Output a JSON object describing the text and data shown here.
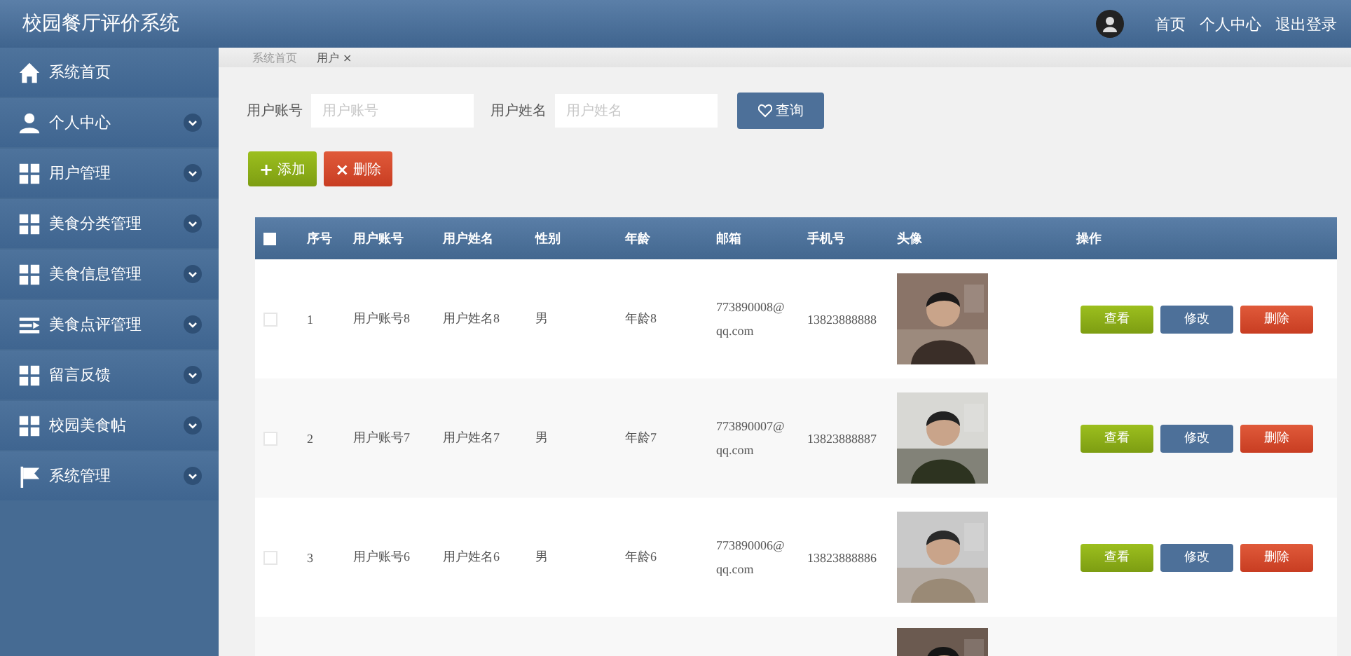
{
  "header": {
    "title": "校园餐厅评价系统",
    "links": [
      "首页",
      "个人中心",
      "退出登录"
    ]
  },
  "sidebar": {
    "items": [
      {
        "label": "系统首页",
        "kind": "link"
      },
      {
        "label": "个人中心",
        "kind": "menu"
      },
      {
        "label": "用户管理",
        "kind": "menu"
      },
      {
        "label": "美食分类管理",
        "kind": "menu"
      },
      {
        "label": "美食信息管理",
        "kind": "menu"
      },
      {
        "label": "美食点评管理",
        "kind": "menu"
      },
      {
        "label": "留言反馈",
        "kind": "menu"
      },
      {
        "label": "校园美食帖",
        "kind": "menu"
      },
      {
        "label": "系统管理",
        "kind": "menu"
      }
    ]
  },
  "breadcrumb": [
    {
      "label": "系统首页",
      "selected": false
    },
    {
      "label": "用户",
      "close": "×",
      "selected": true
    }
  ],
  "search": {
    "fields": [
      {
        "label": "用户账号",
        "placeholder": "用户账号"
      },
      {
        "label": "用户姓名",
        "placeholder": "用户姓名"
      }
    ],
    "button": "查询"
  },
  "actions": [
    {
      "label": "添加",
      "icon": "+",
      "kind": "add"
    },
    {
      "label": "删除",
      "icon": "×",
      "kind": "delete"
    }
  ],
  "table": {
    "select_all": {
      "checked": false
    },
    "columns": [
      "序号",
      "用户账号",
      "用户姓名",
      "性别",
      "年龄",
      "邮箱",
      "手机号",
      "头像",
      "操作"
    ],
    "rows": [
      {
        "checked": false,
        "cells": [
          "1",
          "用户账号8",
          "用户姓名8",
          "男",
          "年龄8",
          "773890008@qq.com",
          "13823888888"
        ],
        "photo": {
          "kind": "picture"
        },
        "buttons": [
          "查看",
          "修改",
          "删除"
        ]
      },
      {
        "checked": false,
        "cells": [
          "2",
          "用户账号7",
          "用户姓名7",
          "男",
          "年龄7",
          "773890007@qq.com",
          "13823888887"
        ],
        "photo": {
          "kind": "picture"
        },
        "buttons": [
          "查看",
          "修改",
          "删除"
        ]
      },
      {
        "checked": false,
        "cells": [
          "3",
          "用户账号6",
          "用户姓名6",
          "男",
          "年龄6",
          "773890006@qq.com",
          "13823888886"
        ],
        "photo": {
          "kind": "picture"
        },
        "buttons": [
          "查看",
          "修改",
          "删除"
        ]
      },
      {
        "photo": {
          "kind": "picture"
        }
      }
    ]
  }
}
